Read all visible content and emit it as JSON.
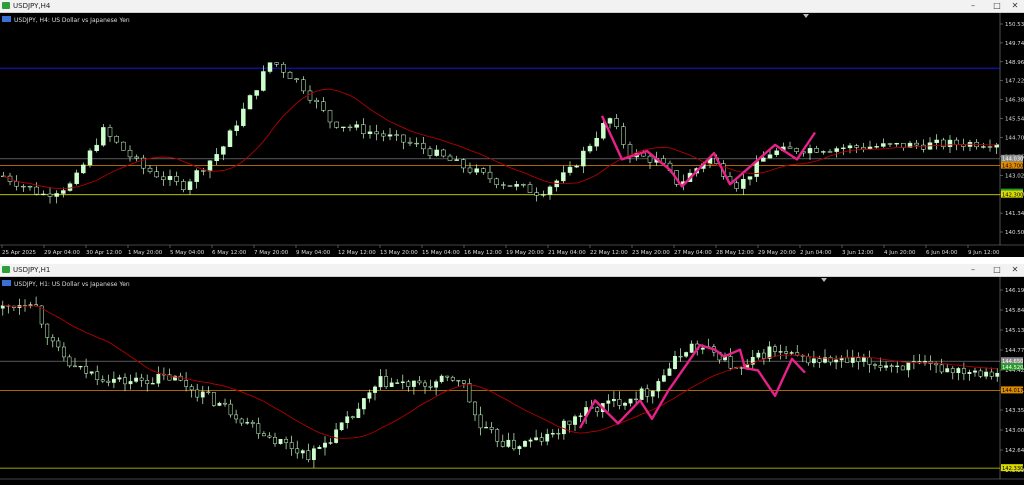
{
  "windows": [
    {
      "id": "h4",
      "title": "USDJPY,H4",
      "subtitle": "USDJPY, H4:  US Dollar vs Japanese Yen",
      "price_ticks": [
        "150.530",
        "149.740",
        "148.960",
        "147.220",
        "146.380",
        "145.540",
        "144.700",
        "143.860",
        "143.020",
        "142.200",
        "141.340",
        "140.500"
      ],
      "price_labels": [
        {
          "text": "144.030",
          "bg": "#8a8a8a",
          "fg": "#ffffff",
          "price": 144.03
        },
        {
          "text": "143.700",
          "bg": "#e08a00",
          "fg": "#000000",
          "price": 143.7
        },
        {
          "text": "142.400",
          "bg": "#2a9a2a",
          "fg": "#ffffff",
          "price": 142.4
        },
        {
          "text": "142.300",
          "bg": "#d9d900",
          "fg": "#000000",
          "price": 142.3
        }
      ],
      "time_labels": [
        "25 Apr 2025",
        "29 Apr 04:00",
        "30 Apr 12:00",
        "1 May 20:00",
        "5 May 04:00",
        "6 May 12:00",
        "7 May 20:00",
        "9 May 04:00",
        "12 May 12:00",
        "13 May 20:00",
        "15 May 04:00",
        "16 May 12:00",
        "19 May 20:00",
        "21 May 04:00",
        "22 May 12:00",
        "23 May 20:00",
        "27 May 04:00",
        "28 May 12:00",
        "29 May 20:00",
        "2 Jun 04:00",
        "3 Jun 12:00",
        "4 Jun 20:00",
        "6 Jun 04:00",
        "9 Jun 12:00"
      ]
    },
    {
      "id": "h1",
      "title": "USDJPY,H1",
      "subtitle": "USDJPY, H1:  US Dollar vs Japanese Yen",
      "price_ticks": [
        "146.195",
        "145.840",
        "145.130",
        "144.775",
        "144.420",
        "143.710",
        "143.355",
        "143.000",
        "142.645",
        "142.290"
      ],
      "price_labels": [
        {
          "text": "144.650",
          "bg": "#8a8a8a",
          "fg": "#ffffff",
          "price": 144.65
        },
        {
          "text": "144.520",
          "bg": "#2a9a2a",
          "fg": "#ffffff",
          "price": 144.52
        },
        {
          "text": "144.017",
          "bg": "#e08a00",
          "fg": "#000000",
          "price": 144.017
        },
        {
          "text": "142.330",
          "bg": "#d9d900",
          "fg": "#000000",
          "price": 142.33
        }
      ],
      "time_labels": []
    }
  ],
  "controls": {
    "minimize": "–",
    "maximize": "□",
    "close": "✕"
  },
  "colors": {
    "candle": "#ccffcc",
    "ma": "#b00000",
    "zigzag": "#e8208a",
    "support": "#e08a00",
    "resistance_blue": "#1a1aff",
    "grid": "#555555",
    "bid": "#8a8a8a"
  }
}
